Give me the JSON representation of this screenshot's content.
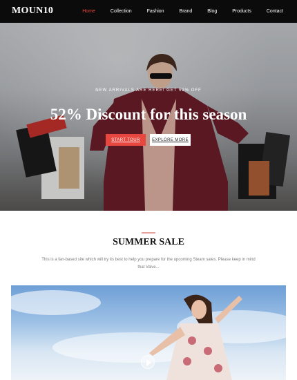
{
  "header": {
    "logo": "MOUN10",
    "nav": [
      {
        "label": "Home",
        "active": true
      },
      {
        "label": "Collection",
        "active": false
      },
      {
        "label": "Fashion",
        "active": false
      },
      {
        "label": "Brand",
        "active": false
      },
      {
        "label": "Blog",
        "active": false
      },
      {
        "label": "Products",
        "active": false
      },
      {
        "label": "Contact",
        "active": false
      }
    ]
  },
  "hero": {
    "kicker": "NEW ARRIVALS ARE HERE! GET 52% OFF",
    "title": "52% Discount for this season",
    "primary_button": "Start Tour",
    "secondary_button": "Explore More"
  },
  "section": {
    "title": "SUMMER SALE",
    "text": "This is a fan-based site which will try its best to help you prepare for the upcoming Steam sales. Please keep in mind that Valve..."
  },
  "colors": {
    "accent": "#e8473f",
    "header_bg": "#0b0b0b"
  },
  "icons": {
    "play": "play-icon"
  }
}
